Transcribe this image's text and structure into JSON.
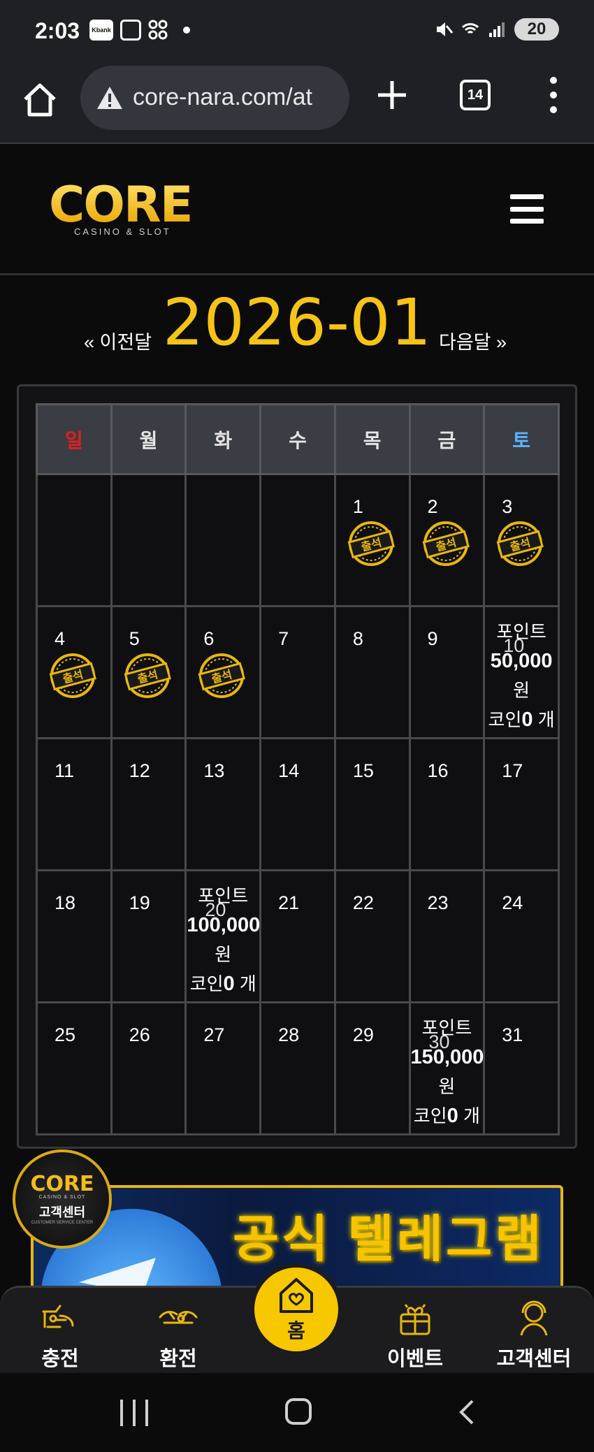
{
  "status_bar": {
    "time": "2:03",
    "kbank_label": "Kbank",
    "battery": "20"
  },
  "browser": {
    "url": "core-nara.com/at",
    "tab_count": "14"
  },
  "site": {
    "logo_main": "CORE",
    "logo_sub": "CASINO & SLOT"
  },
  "calendar": {
    "prev_label": "« 이전달",
    "next_label": "다음달 »",
    "month_title": "2026-01",
    "weekdays": [
      "일",
      "월",
      "화",
      "수",
      "목",
      "금",
      "토"
    ],
    "attendance_stamp_label": "출석",
    "days": {
      "d1": "1",
      "d2": "2",
      "d3": "3",
      "d4": "4",
      "d5": "5",
      "d6": "6",
      "d7": "7",
      "d8": "8",
      "d9": "9",
      "d10": "10",
      "d11": "11",
      "d12": "12",
      "d13": "13",
      "d14": "14",
      "d15": "15",
      "d16": "16",
      "d17": "17",
      "d18": "18",
      "d19": "19",
      "d20": "20",
      "d21": "21",
      "d22": "22",
      "d23": "23",
      "d24": "24",
      "d25": "25",
      "d26": "26",
      "d27": "27",
      "d28": "28",
      "d29": "29",
      "d30": "30",
      "d31": "31"
    },
    "rewards": {
      "r10": {
        "point_label": "포인트",
        "amount": "50,000",
        "unit": "원",
        "coin_prefix": "코인",
        "coin_value": "0",
        "coin_unit": " 개"
      },
      "r20": {
        "point_label": "포인트",
        "amount": "100,000",
        "unit": "원",
        "coin_prefix": "코인",
        "coin_value": "0",
        "coin_unit": " 개"
      },
      "r30": {
        "point_label": "포인트",
        "amount": "150,000",
        "unit": "원",
        "coin_prefix": "코인",
        "coin_value": "0",
        "coin_unit": " 개"
      }
    },
    "attended_days": [
      1,
      2,
      3,
      4,
      5,
      6
    ]
  },
  "customer_float": {
    "logo": "CORE",
    "sub": "CASINO & SLOT",
    "label": "고객센터",
    "caption": "CUSTOMER SERVICE CENTER"
  },
  "banner": {
    "text": "공식 텔레그램"
  },
  "bottom_nav": {
    "charge": "충전",
    "exchange": "환전",
    "home": "홈",
    "event": "이벤트",
    "support": "고객센터"
  },
  "colors": {
    "accent_gold": "#f7c414",
    "sunday_red": "#e01f1f",
    "saturday_blue": "#5bb4ff"
  }
}
